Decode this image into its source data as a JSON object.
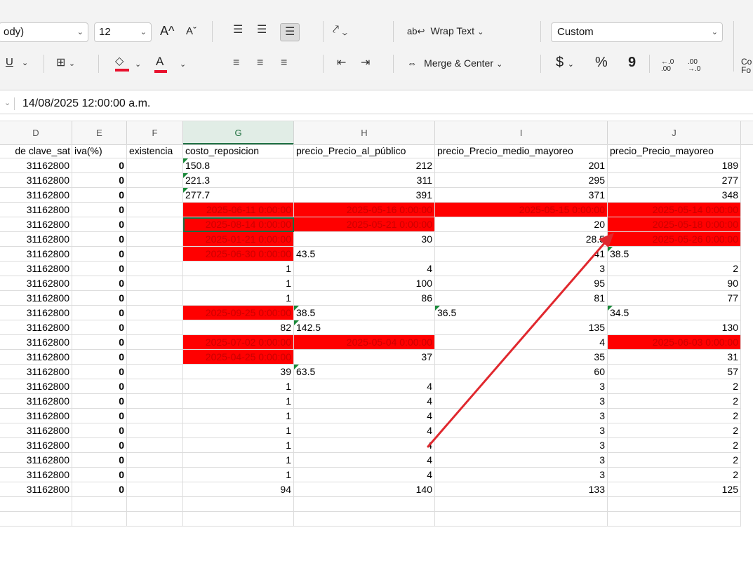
{
  "ribbon": {
    "font_name": "ody)",
    "font_size": "12",
    "grow_font": "A^",
    "shrink_font": "Aˇ",
    "wrap_text_label": "Wrap Text",
    "merge_center_label": "Merge & Center",
    "number_format_value": "Custom",
    "currency_symbol": "$",
    "percent_symbol": "%",
    "comma_symbol": "9",
    "increase_decimal": "←.0 .00",
    "decrease_decimal": ".00 →.0",
    "cond_format_label": "Co\nFo",
    "underline_label": "U",
    "text_color_label": "A",
    "accent_red": "#ff0000"
  },
  "formula_bar": {
    "value": "14/08/2025  12:00:00 a.m."
  },
  "columns": [
    {
      "letter": "D",
      "header": "de clave_sat"
    },
    {
      "letter": "E",
      "header": "iva(%)"
    },
    {
      "letter": "F",
      "header": "existencia"
    },
    {
      "letter": "G",
      "header": "costo_reposicion"
    },
    {
      "letter": "H",
      "header": "precio_Precio_al_público"
    },
    {
      "letter": "I",
      "header": "precio_Precio_medio_mayoreo"
    },
    {
      "letter": "J",
      "header": "precio_Precio_mayoreo"
    }
  ],
  "rows": [
    [
      "31162800",
      "0",
      "",
      "150.8",
      "212",
      "201",
      "189"
    ],
    [
      "31162800",
      "0",
      "",
      "221.3",
      "311",
      "295",
      "277"
    ],
    [
      "31162800",
      "0",
      "",
      "277.7",
      "391",
      "371",
      "348"
    ],
    [
      "31162800",
      "0",
      "",
      "2025-06-11 0:00:00",
      "2025-05-16 0:00:00",
      "2025-05-15 0:00:00",
      "2025-05-14 0:00:00"
    ],
    [
      "31162800",
      "0",
      "",
      "2025-08-14 0:00:00",
      "2025-05-21 0:00:00",
      "20",
      "2025-05-18 0:00:00"
    ],
    [
      "31162800",
      "0",
      "",
      "2025-01-21 0:00:00",
      "30",
      "28.5",
      "2025-05-26 0:00:00"
    ],
    [
      "31162800",
      "0",
      "",
      "2025-06-30 0:00:00",
      "43.5",
      "41",
      "38.5"
    ],
    [
      "31162800",
      "0",
      "",
      "1",
      "4",
      "3",
      "2"
    ],
    [
      "31162800",
      "0",
      "",
      "1",
      "100",
      "95",
      "90"
    ],
    [
      "31162800",
      "0",
      "",
      "1",
      "86",
      "81",
      "77"
    ],
    [
      "31162800",
      "0",
      "",
      "2025-09-25 0:00:00",
      "38.5",
      "36.5",
      "34.5"
    ],
    [
      "31162800",
      "0",
      "",
      "82",
      "142.5",
      "135",
      "130"
    ],
    [
      "31162800",
      "0",
      "",
      "2025-07-02 0:00:00",
      "2025-05-04 0:00:00",
      "4",
      "2025-06-03 0:00:00"
    ],
    [
      "31162800",
      "0",
      "",
      "2025-04-25 0:00:00",
      "37",
      "35",
      "31"
    ],
    [
      "31162800",
      "0",
      "",
      "39",
      "63.5",
      "60",
      "57"
    ],
    [
      "31162800",
      "0",
      "",
      "1",
      "4",
      "3",
      "2"
    ],
    [
      "31162800",
      "0",
      "",
      "1",
      "4",
      "3",
      "2"
    ],
    [
      "31162800",
      "0",
      "",
      "1",
      "4",
      "3",
      "2"
    ],
    [
      "31162800",
      "0",
      "",
      "1",
      "4",
      "3",
      "2"
    ],
    [
      "31162800",
      "0",
      "",
      "1",
      "4",
      "3",
      "2"
    ],
    [
      "31162800",
      "0",
      "",
      "1",
      "4",
      "3",
      "2"
    ],
    [
      "31162800",
      "0",
      "",
      "1",
      "4",
      "3",
      "2"
    ],
    [
      "31162800",
      "0",
      "",
      "94",
      "140",
      "133",
      "125"
    ],
    [
      "",
      "",
      "",
      "",
      "",
      "",
      ""
    ],
    [
      "",
      "",
      "",
      "",
      "",
      "",
      ""
    ]
  ],
  "red_cells": [
    [
      3,
      3
    ],
    [
      3,
      4
    ],
    [
      3,
      5
    ],
    [
      3,
      6
    ],
    [
      4,
      3
    ],
    [
      4,
      4
    ],
    [
      4,
      6
    ],
    [
      5,
      3
    ],
    [
      5,
      6
    ],
    [
      6,
      3
    ],
    [
      10,
      3
    ],
    [
      12,
      3
    ],
    [
      12,
      4
    ],
    [
      12,
      6
    ],
    [
      13,
      3
    ]
  ],
  "text_left_cells": [
    [
      0,
      3
    ],
    [
      1,
      3
    ],
    [
      2,
      3
    ],
    [
      6,
      4
    ],
    [
      6,
      6
    ],
    [
      10,
      4
    ],
    [
      10,
      5
    ],
    [
      10,
      6
    ],
    [
      11,
      4
    ],
    [
      14,
      4
    ]
  ],
  "green_marker_cells": [
    [
      0,
      3
    ],
    [
      1,
      3
    ],
    [
      2,
      3
    ],
    [
      6,
      6
    ],
    [
      10,
      4
    ],
    [
      10,
      5
    ],
    [
      10,
      6
    ],
    [
      11,
      4
    ],
    [
      14,
      4
    ]
  ],
  "active_cell": [
    4,
    3
  ],
  "annotation_color": "#e0282e"
}
